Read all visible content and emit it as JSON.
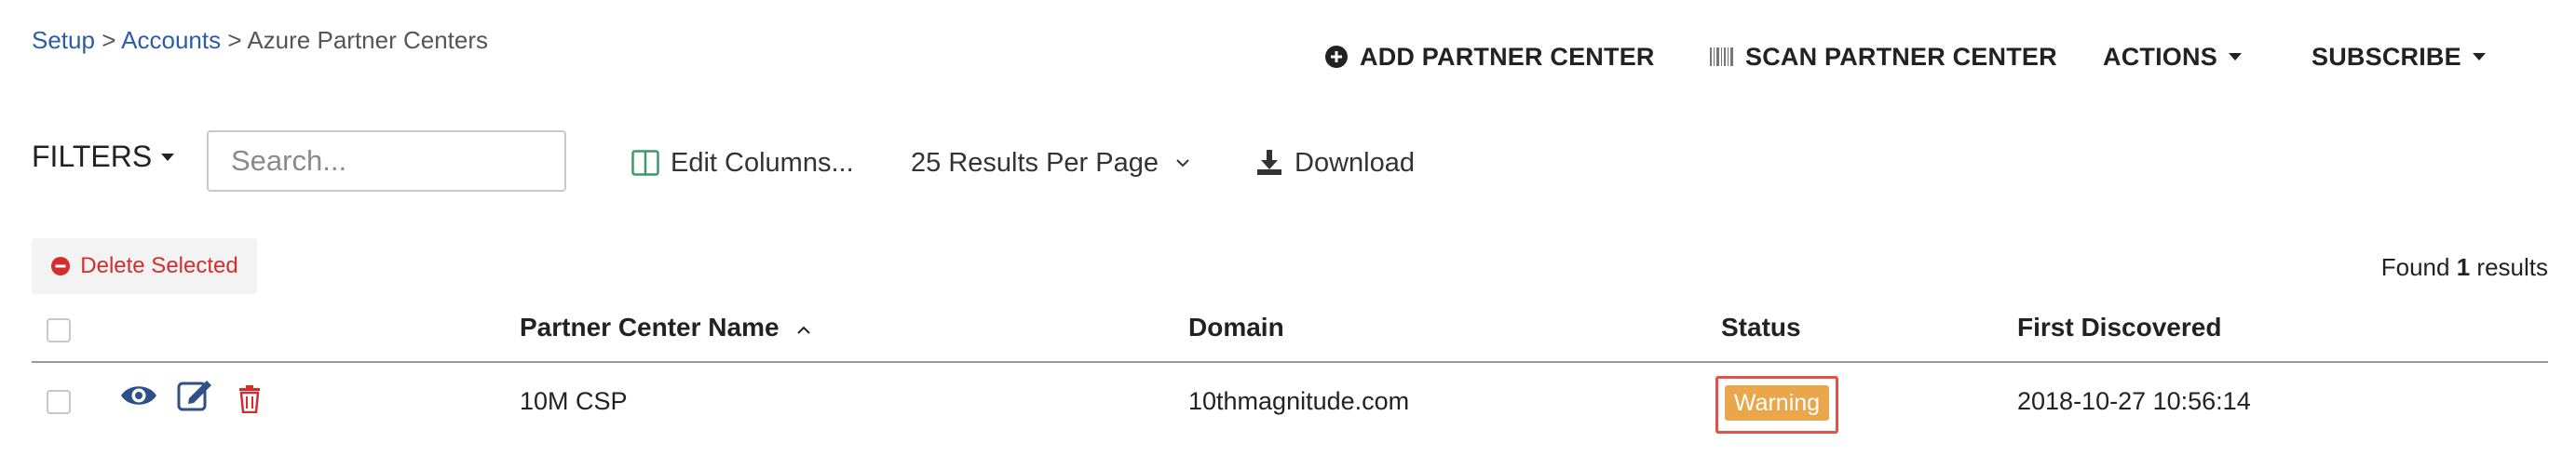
{
  "breadcrumb": {
    "items": [
      "Setup",
      "Accounts",
      "Azure Partner Centers"
    ],
    "separator": ">"
  },
  "toolbar": {
    "add_label": "ADD PARTNER CENTER",
    "scan_label": "SCAN PARTNER CENTER",
    "actions_label": "ACTIONS",
    "subscribe_label": "SUBSCRIBE"
  },
  "filters": {
    "label": "FILTERS",
    "search_placeholder": "Search...",
    "search_value": "",
    "edit_columns_label": "Edit Columns...",
    "per_page_label": "25 Results Per Page",
    "download_label": "Download"
  },
  "actions": {
    "delete_selected_label": "Delete Selected"
  },
  "results": {
    "prefix": "Found",
    "count": "1",
    "suffix": "results"
  },
  "table": {
    "columns": [
      "Partner Center Name",
      "Domain",
      "Status",
      "First Discovered"
    ],
    "sort_column": "Partner Center Name",
    "sort_direction": "ascending",
    "rows": [
      {
        "name": "10M CSP",
        "domain": "10thmagnitude.com",
        "status": "Warning",
        "first_discovered": "2018-10-27 10:56:14"
      }
    ]
  },
  "colors": {
    "link": "#2d5ca8",
    "danger": "#d32d2d",
    "warning_badge": "#eaa64b",
    "highlight_box": "#e0524a",
    "icon_blue": "#2f4f86",
    "icon_green": "#3a9a6a"
  },
  "icons": {
    "add": "plus-circle-icon",
    "scan": "barcode-icon",
    "edit_columns": "columns-icon",
    "per_page": "chevron-down-icon",
    "download": "download-icon",
    "delete": "minus-circle-icon",
    "sort": "sort-up-icon",
    "view": "eye-icon",
    "edit": "edit-icon",
    "trash": "trash-icon"
  }
}
